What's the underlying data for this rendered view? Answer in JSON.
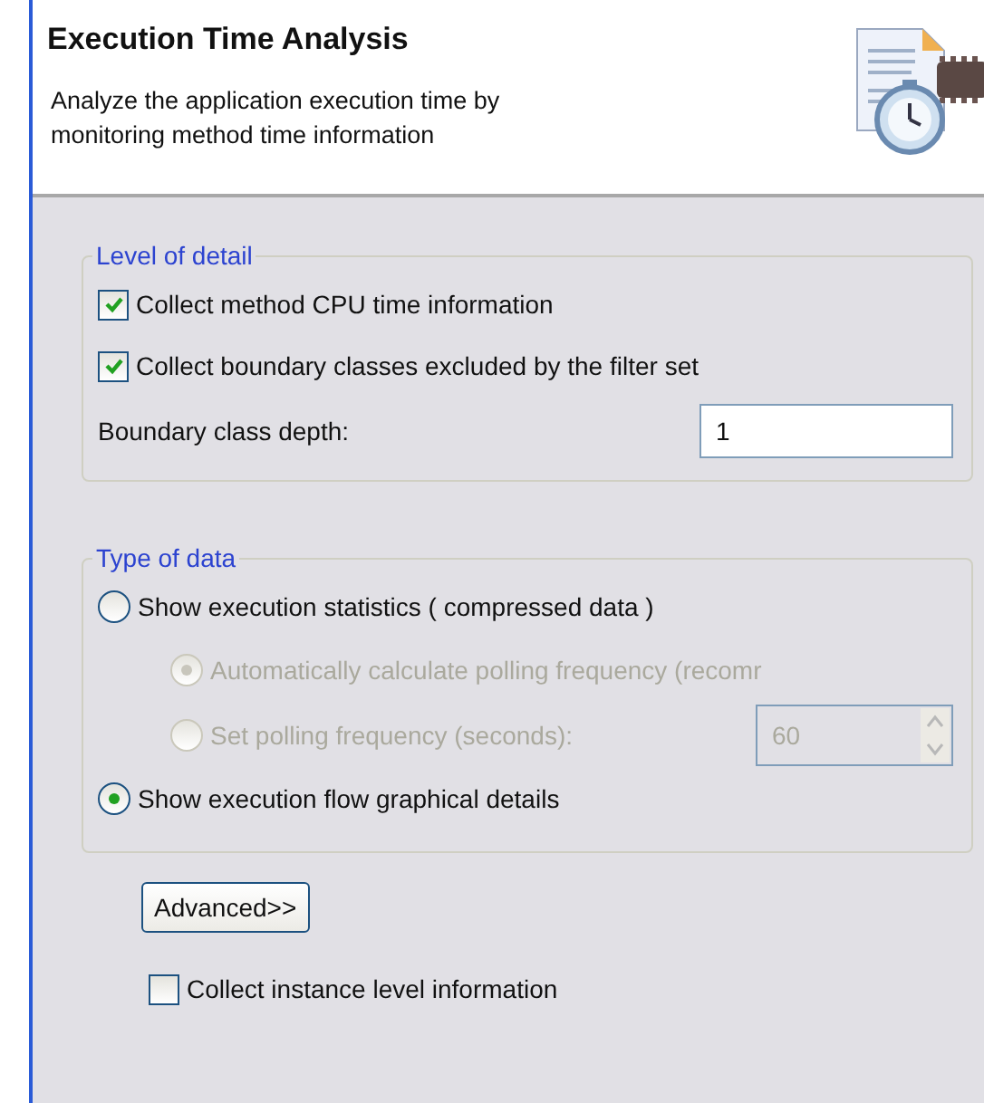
{
  "header": {
    "title": "Execution Time Analysis",
    "description": "Analyze the application execution time by monitoring method time information"
  },
  "level_of_detail": {
    "legend": "Level of detail",
    "options": [
      {
        "label": "Collect method CPU time information",
        "checked": true
      },
      {
        "label": "Collect boundary classes excluded by the filter set",
        "checked": true
      }
    ],
    "depth": {
      "label": "Boundary class depth:",
      "value": "1"
    }
  },
  "type_of_data": {
    "legend": "Type of data",
    "options": [
      {
        "label": "Show execution statistics ( compressed data )",
        "selected": false,
        "disabled": false,
        "children": [
          {
            "label": "Automatically calculate polling frequency (recomr",
            "selected": true,
            "disabled": true
          },
          {
            "label": "Set polling frequency (seconds):",
            "selected": false,
            "disabled": true,
            "spinner": "60"
          }
        ]
      },
      {
        "label": "Show execution flow graphical details",
        "selected": true,
        "disabled": false
      }
    ]
  },
  "advanced_button": "Advanced>>",
  "instance_option": {
    "label": "Collect instance level information",
    "checked": false
  }
}
